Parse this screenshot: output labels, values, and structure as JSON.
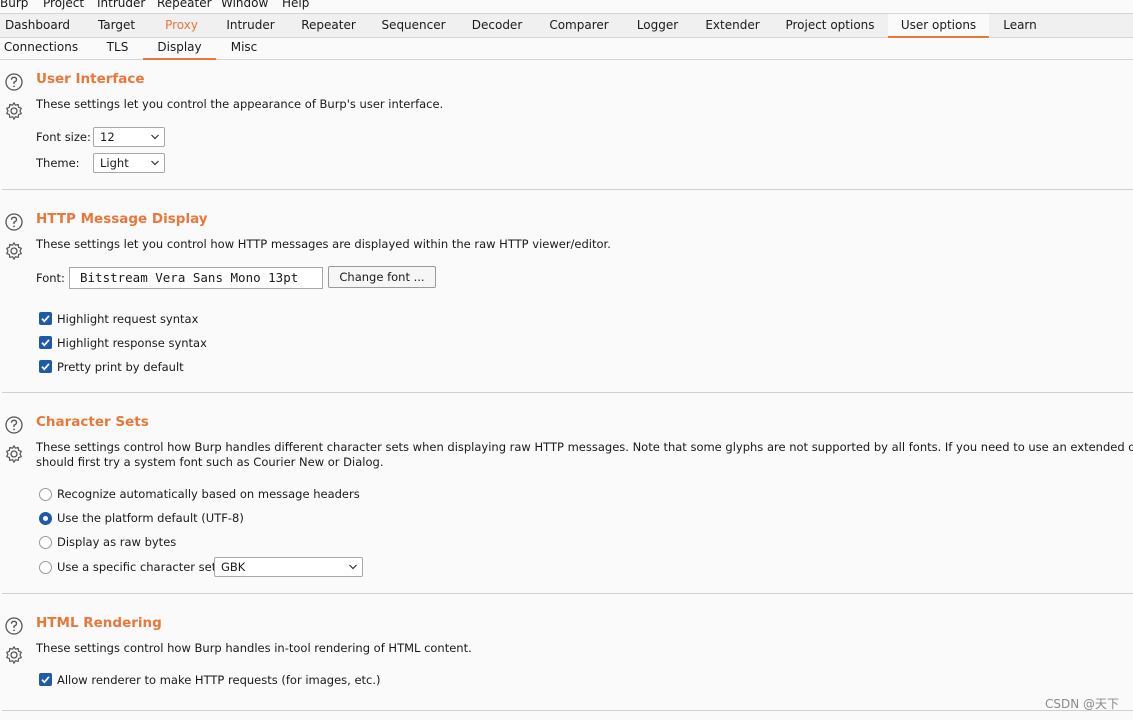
{
  "menubar": [
    "Burp",
    "Project",
    "Intruder",
    "Repeater",
    "Window",
    "Help"
  ],
  "tabs": [
    "Dashboard",
    "Target",
    "Proxy",
    "Intruder",
    "Repeater",
    "Sequencer",
    "Decoder",
    "Comparer",
    "Logger",
    "Extender",
    "Project options",
    "User options",
    "Learn"
  ],
  "active_tab": "User options",
  "highlighted_tab": "Proxy",
  "subtabs": [
    "Connections",
    "TLS",
    "Display",
    "Misc"
  ],
  "active_subtab": "Display",
  "accent_color": "#e8773a",
  "checkbox_color": "#1e5aa8",
  "sections": {
    "ui": {
      "title": "User Interface",
      "desc": "These settings let you control the appearance of Burp's user interface.",
      "font_size_label": "Font size:",
      "font_size_value": "12",
      "theme_label": "Theme:",
      "theme_value": "Light"
    },
    "http": {
      "title": "HTTP Message Display",
      "desc": "These settings let you control how HTTP messages are displayed within the raw HTTP viewer/editor.",
      "font_label": "Font:",
      "font_value": "Bitstream Vera Sans Mono 13pt",
      "change_font_button": "Change font ...",
      "checkboxes": [
        "Highlight request syntax",
        "Highlight response syntax",
        "Pretty print by default"
      ],
      "checked": [
        true,
        true,
        true
      ]
    },
    "charset": {
      "title": "Character Sets",
      "desc_line1": "These settings control how Burp handles different character sets when displaying raw HTTP messages. Note that some glyphs are not supported by all fonts. If you need to use an extended or unusual char",
      "desc_line2": "should first try a system font such as Courier New or Dialog.",
      "radios": [
        "Recognize automatically based on message headers",
        "Use the platform default (UTF-8)",
        "Display as raw bytes",
        "Use a specific character set:"
      ],
      "selected_radio": "Use the platform default (UTF-8)",
      "charset_value": "GBK"
    },
    "html": {
      "title": "HTML Rendering",
      "desc": "These settings control how Burp handles in-tool rendering of HTML content.",
      "checkbox": "Allow renderer to make HTTP requests (for images, etc.)",
      "checked": true
    }
  },
  "watermark": "CSDN @天下"
}
